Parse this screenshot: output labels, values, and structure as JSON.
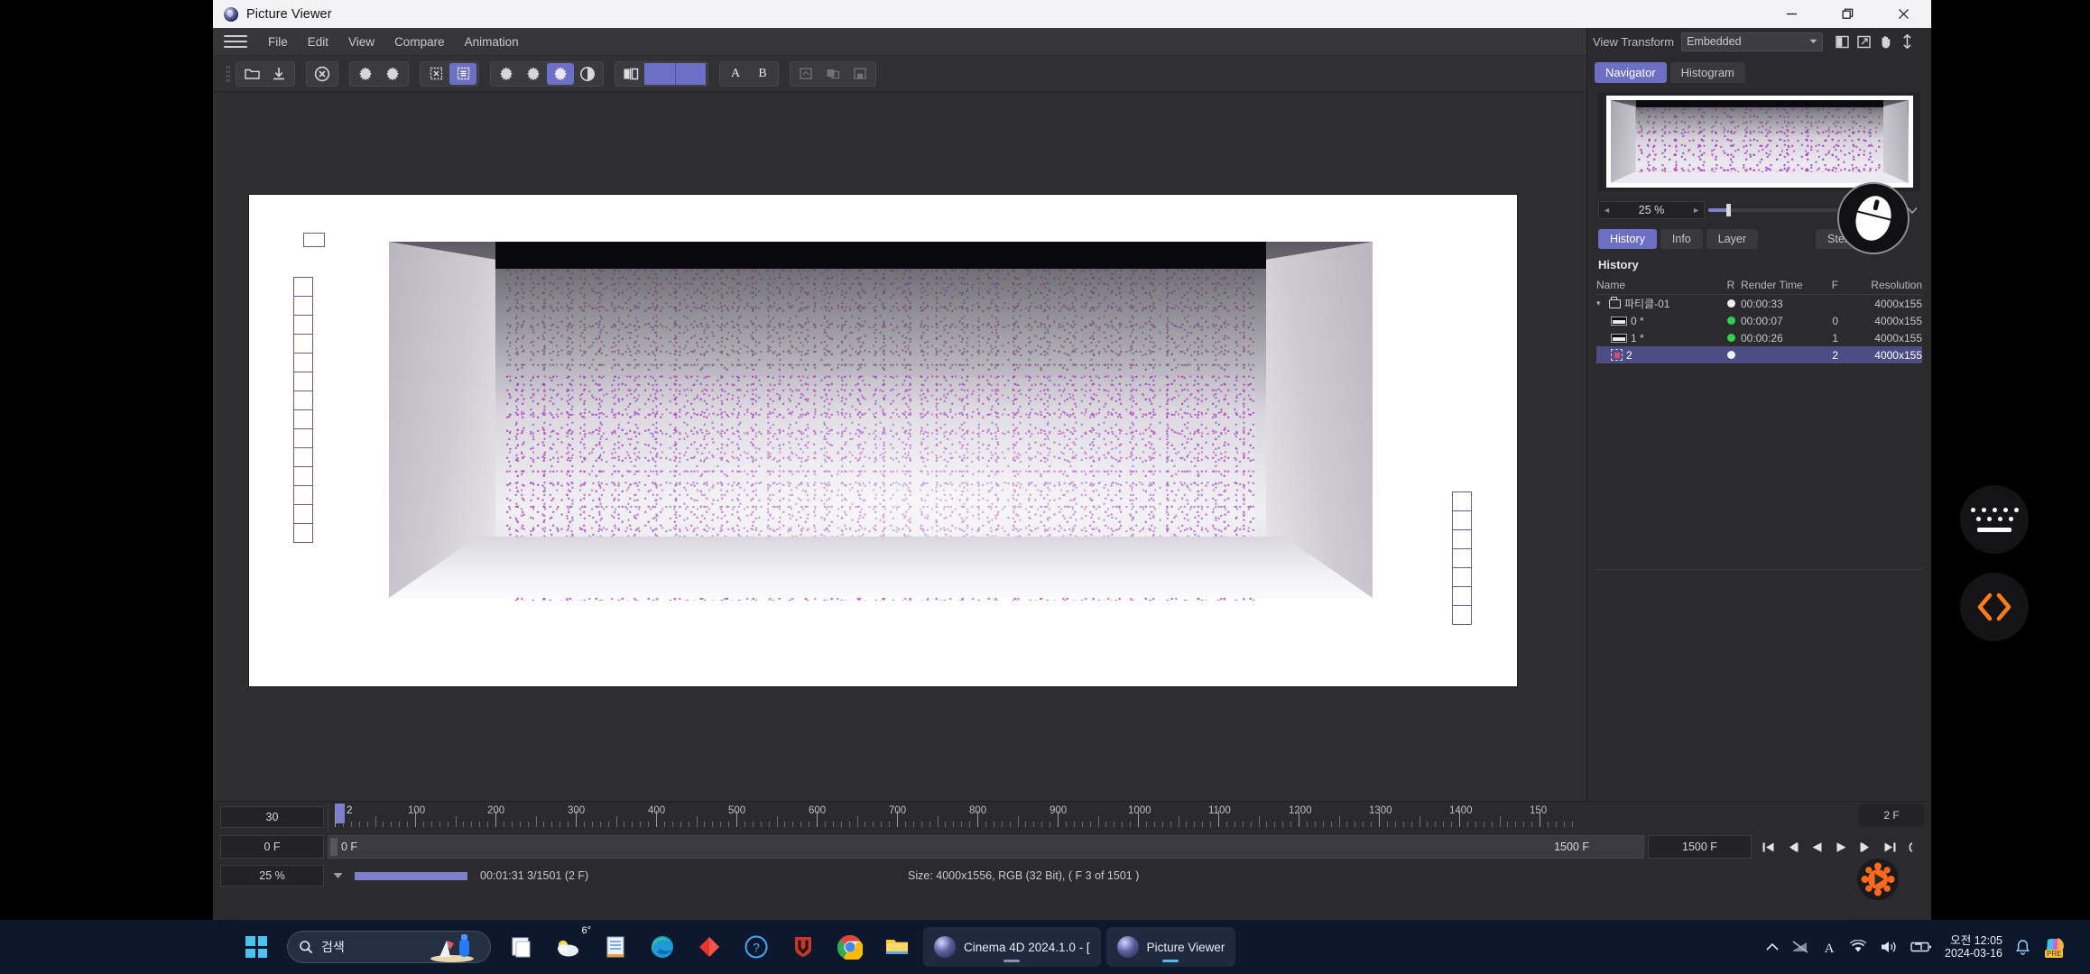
{
  "window": {
    "title": "Picture Viewer",
    "controls": {
      "minimize": "minimize-button",
      "restore": "restore-button",
      "close": "close-button"
    }
  },
  "menu": {
    "items": [
      "File",
      "Edit",
      "View",
      "Compare",
      "Animation"
    ]
  },
  "toolbar": {
    "groups": [
      {
        "items": [
          {
            "icon": "open-folder-icon",
            "state": "normal"
          },
          {
            "icon": "save-download-icon",
            "state": "normal"
          }
        ]
      },
      {
        "items": [
          {
            "icon": "cancel-render-icon",
            "state": "normal"
          }
        ]
      },
      {
        "items": [
          {
            "icon": "gear-render-icon",
            "state": "normal"
          },
          {
            "icon": "gear-render-region-icon",
            "state": "normal"
          }
        ]
      },
      {
        "items": [
          {
            "icon": "chip-stop-icon",
            "state": "normal"
          },
          {
            "icon": "chip-list-icon",
            "state": "active"
          }
        ]
      },
      {
        "items": [
          {
            "icon": "gear-a-icon",
            "state": "normal"
          },
          {
            "icon": "gear-b-icon",
            "state": "normal"
          },
          {
            "icon": "gear-c-icon",
            "state": "active"
          },
          {
            "icon": "contrast-icon",
            "state": "normal"
          }
        ]
      },
      {
        "items": [
          {
            "icon": "ab-compare-icon",
            "state": "normal"
          },
          {
            "icon": "swatch-a",
            "state": "swatch"
          },
          {
            "icon": "swatch-b",
            "state": "swatch"
          }
        ]
      },
      {
        "items": [
          {
            "icon": "letter-a",
            "label": "A"
          },
          {
            "icon": "letter-b",
            "label": "B"
          }
        ]
      },
      {
        "items": [
          {
            "icon": "layer-add-icon",
            "state": "disabled"
          },
          {
            "icon": "layer-merge-icon",
            "state": "disabled"
          },
          {
            "icon": "layer-save-icon",
            "state": "disabled"
          }
        ]
      }
    ]
  },
  "dock": {
    "view_transform": {
      "label": "View Transform",
      "value": "Embedded"
    },
    "view_icons": [
      "split-view-icon",
      "external-window-icon",
      "pan-hand-icon",
      "vertical-fit-icon"
    ],
    "tabs": [
      {
        "label": "Navigator",
        "selected": true
      },
      {
        "label": "Histogram",
        "selected": false
      }
    ],
    "zoom": {
      "value": "25 %",
      "left_arrow": "◄",
      "right_arrow": "►"
    },
    "subtabs": [
      {
        "label": "History",
        "selected": true
      },
      {
        "label": "Info",
        "selected": false
      },
      {
        "label": "Layer",
        "selected": false
      },
      {
        "label": "Stereo",
        "selected": false
      }
    ],
    "history": {
      "title": "History",
      "columns": [
        "Name",
        "R",
        "Render Time",
        "F",
        "Resolution"
      ],
      "rows": [
        {
          "name": "파티클-01",
          "type": "folder",
          "expanded": true,
          "indent": 0,
          "r": "white",
          "render_time": "00:00:33",
          "f": "",
          "resolution": "4000x155",
          "selected": false
        },
        {
          "name": "0 *",
          "type": "film",
          "indent": 1,
          "r": "green",
          "render_time": "00:00:07",
          "f": "0",
          "resolution": "4000x155",
          "selected": false
        },
        {
          "name": "1 *",
          "type": "film",
          "indent": 1,
          "r": "green",
          "render_time": "00:00:26",
          "f": "1",
          "resolution": "4000x155",
          "selected": false
        },
        {
          "name": "2",
          "type": "chip",
          "indent": 1,
          "r": "white",
          "render_time": "",
          "f": "2",
          "resolution": "4000x155",
          "selected": true
        }
      ]
    }
  },
  "timeline": {
    "fps": "30",
    "start_frame_box": "0 F",
    "bar_start_label": "0 F",
    "bar_end_label": "1500 F",
    "end_frame_box": "1500 F",
    "current_frame_marker": "2",
    "frames_badge": "2 F",
    "ruler_labels": [
      "100",
      "200",
      "300",
      "400",
      "500",
      "600",
      "700",
      "800",
      "900",
      "1000",
      "1100",
      "1200",
      "1300",
      "1400",
      "150"
    ],
    "transport": [
      "go-to-start-icon",
      "step-back-icon",
      "play-back-icon",
      "play-forward-icon",
      "step-forward-icon",
      "go-to-end-icon",
      "loop-icon"
    ]
  },
  "status": {
    "zoom": "25 %",
    "progress_text": "00:01:31 3/1501 (2 F)",
    "size_text": "Size: 4000x1556, RGB (32 Bit),  ( F 3 of 1501 )"
  },
  "taskbar": {
    "search_placeholder": "검색",
    "apps": [
      {
        "name": "windows-start",
        "label": ""
      },
      {
        "name": "paint-icon",
        "label": ""
      },
      {
        "name": "weather-icon",
        "label": "6°"
      },
      {
        "name": "notepad-icon",
        "label": ""
      },
      {
        "name": "edge-icon",
        "label": ""
      },
      {
        "name": "diamond-app-icon",
        "label": ""
      },
      {
        "name": "help-icon",
        "label": ""
      },
      {
        "name": "shield-app-icon",
        "label": ""
      },
      {
        "name": "chrome-icon",
        "label": ""
      },
      {
        "name": "file-explorer-icon",
        "label": ""
      }
    ],
    "tasks": [
      {
        "name": "cinema4d-task",
        "label": "Cinema 4D 2024.1.0 - ["
      },
      {
        "name": "picture-viewer-task",
        "label": "Picture Viewer"
      }
    ],
    "tray": [
      "chevron-up-icon",
      "network-off-icon",
      "ime-a-icon",
      "wifi-icon",
      "volume-icon",
      "battery-icon"
    ],
    "clock": {
      "time": "오전 12:05",
      "date": "2024-03-16"
    }
  },
  "overlays": {
    "keyboard_fab": "keyboard-icon",
    "code_fab": "code-brackets-icon",
    "cursor": "mouse-cursor-highlight"
  },
  "colors": {
    "accent": "#6d6fc4",
    "panel": "#2b2b2e",
    "toolbar": "#313135",
    "taskbar": "#0e182d",
    "orange": "#ff6a1e"
  }
}
